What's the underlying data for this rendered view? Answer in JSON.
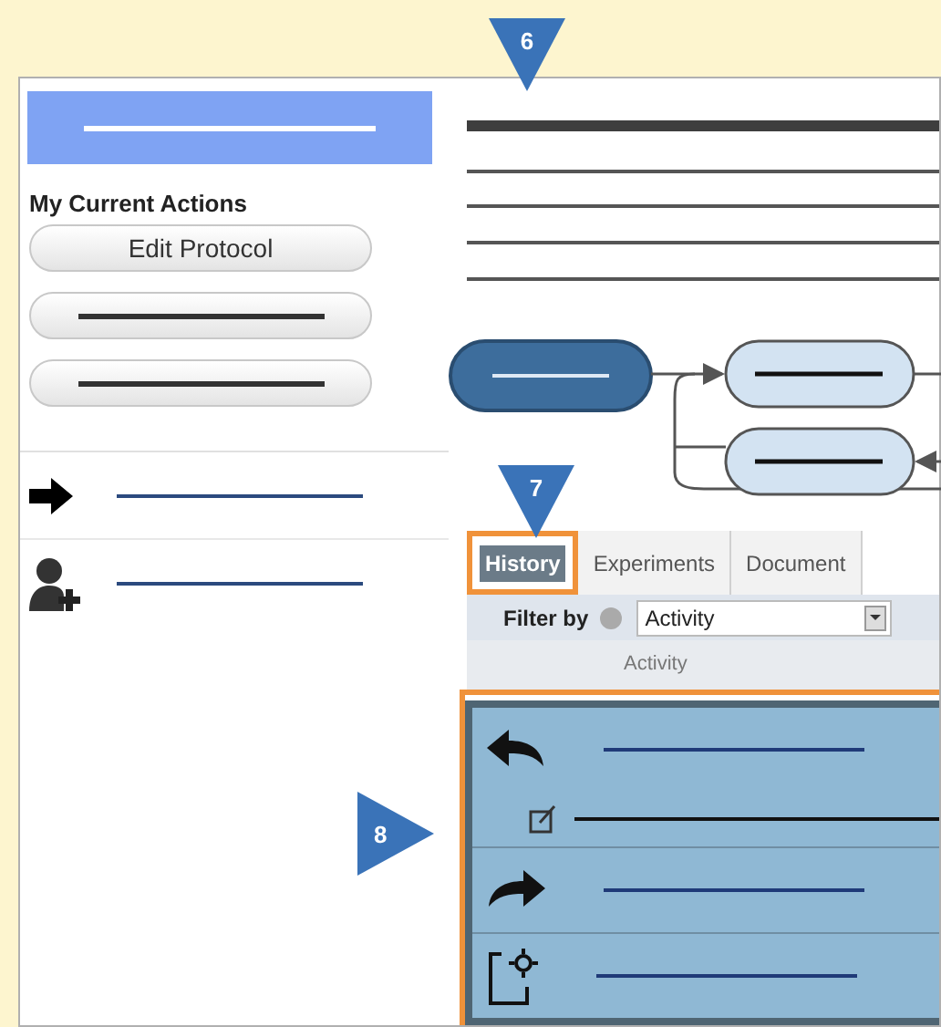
{
  "callouts": [
    {
      "label": "6",
      "kind": "down"
    },
    {
      "label": "7",
      "kind": "down"
    },
    {
      "label": "8",
      "kind": "right"
    }
  ],
  "sidebar": {
    "section_title": "My Current Actions",
    "actions": [
      {
        "kind": "labeled",
        "label": "Edit Protocol"
      },
      {
        "kind": "blank"
      },
      {
        "kind": "blank"
      }
    ],
    "links": [
      {
        "kind": "arrow"
      },
      {
        "kind": "user-add"
      }
    ]
  },
  "tabs": [
    {
      "label": "History",
      "selected": true
    },
    {
      "label": "Experiments",
      "selected": false
    },
    {
      "label": "Document",
      "selected": false
    }
  ],
  "filter": {
    "label": "Filter by",
    "value": "Activity"
  },
  "table": {
    "columns": [
      "Activity"
    ],
    "rows": [
      {
        "kind": "undo",
        "children": [
          {
            "kind": "edit"
          }
        ]
      },
      {
        "kind": "redo"
      },
      {
        "kind": "new"
      }
    ]
  }
}
